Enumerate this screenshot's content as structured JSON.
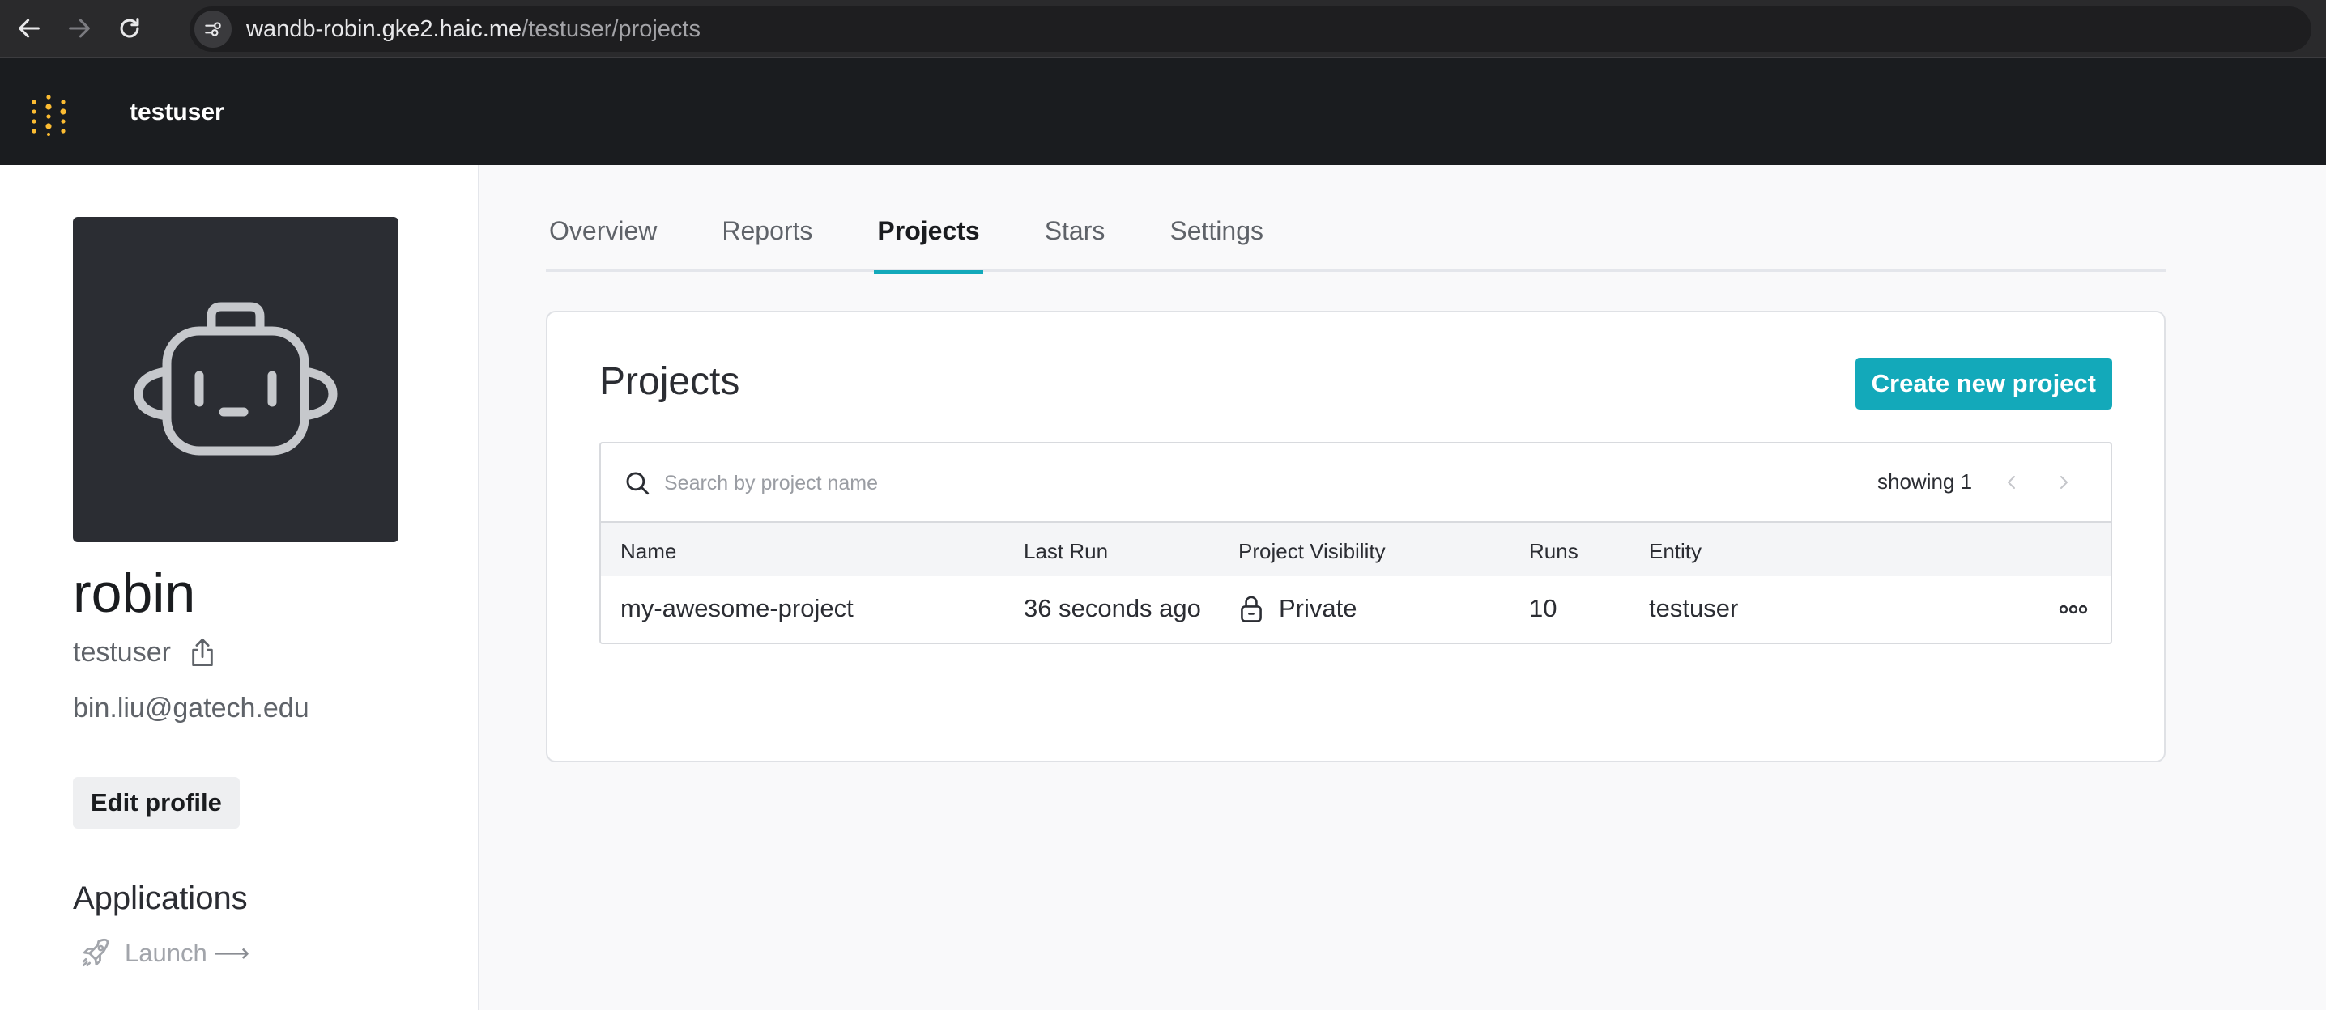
{
  "browser": {
    "url_host": "wandb-robin.gke2.haic.me",
    "url_path": "/testuser/projects"
  },
  "header": {
    "entity": "testuser"
  },
  "profile": {
    "name": "robin",
    "username": "testuser",
    "email": "bin.liu@gatech.edu",
    "edit_label": "Edit profile",
    "applications_heading": "Applications",
    "launch_label": "Launch",
    "launch_arrow": "⟶"
  },
  "tabs": [
    {
      "label": "Overview",
      "active": false
    },
    {
      "label": "Reports",
      "active": false
    },
    {
      "label": "Projects",
      "active": true
    },
    {
      "label": "Stars",
      "active": false
    },
    {
      "label": "Settings",
      "active": false
    }
  ],
  "projects": {
    "title": "Projects",
    "create_label": "Create new project",
    "search_placeholder": "Search by project name",
    "showing": "showing 1",
    "columns": [
      "Name",
      "Last Run",
      "Project Visibility",
      "Runs",
      "Entity"
    ],
    "rows": [
      {
        "name": "my-awesome-project",
        "last_run": "36 seconds ago",
        "visibility": "Private",
        "runs": "10",
        "entity": "testuser"
      }
    ]
  },
  "colors": {
    "accent": "#13a9ba",
    "header_bg": "#1a1c1f",
    "logo": "#fcbc32"
  },
  "icons": [
    "back-arrow-icon",
    "forward-arrow-icon",
    "reload-icon",
    "site-settings-icon",
    "wandb-logo",
    "robot-avatar-icon",
    "share-icon",
    "rocket-icon",
    "search-icon",
    "chevron-left-icon",
    "chevron-right-icon",
    "lock-icon",
    "more-horizontal-icon"
  ]
}
